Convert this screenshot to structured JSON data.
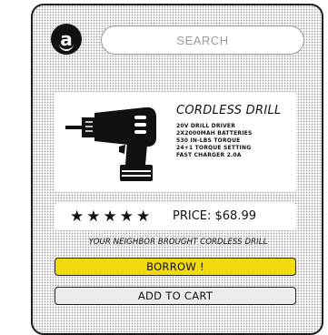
{
  "header": {
    "logo_letter": "a",
    "search_placeholder": "SEARCH"
  },
  "product": {
    "title": "CORDLESS DRILL",
    "specs": [
      "20V DRILL DRIVER",
      "2X2000MAH BATTERIES",
      "530 IN-LBS TORQUE",
      "24+1 TORQUE SETTING",
      "FAST CHARGER 2.0A"
    ],
    "image_icon": "cordless-drill-icon",
    "rating_stars": "★★★★★",
    "rating": 5,
    "price": "PRICE: $68.99"
  },
  "social": {
    "message": "YOUR NEIGHBOR BROUGHT CORDLESS DRILL"
  },
  "actions": {
    "borrow_label": "BORROW !",
    "add_to_cart_label": "ADD TO CART"
  },
  "colors": {
    "borrow_button": "#f1db0e",
    "cart_button": "#ececec",
    "ink": "#111111"
  }
}
